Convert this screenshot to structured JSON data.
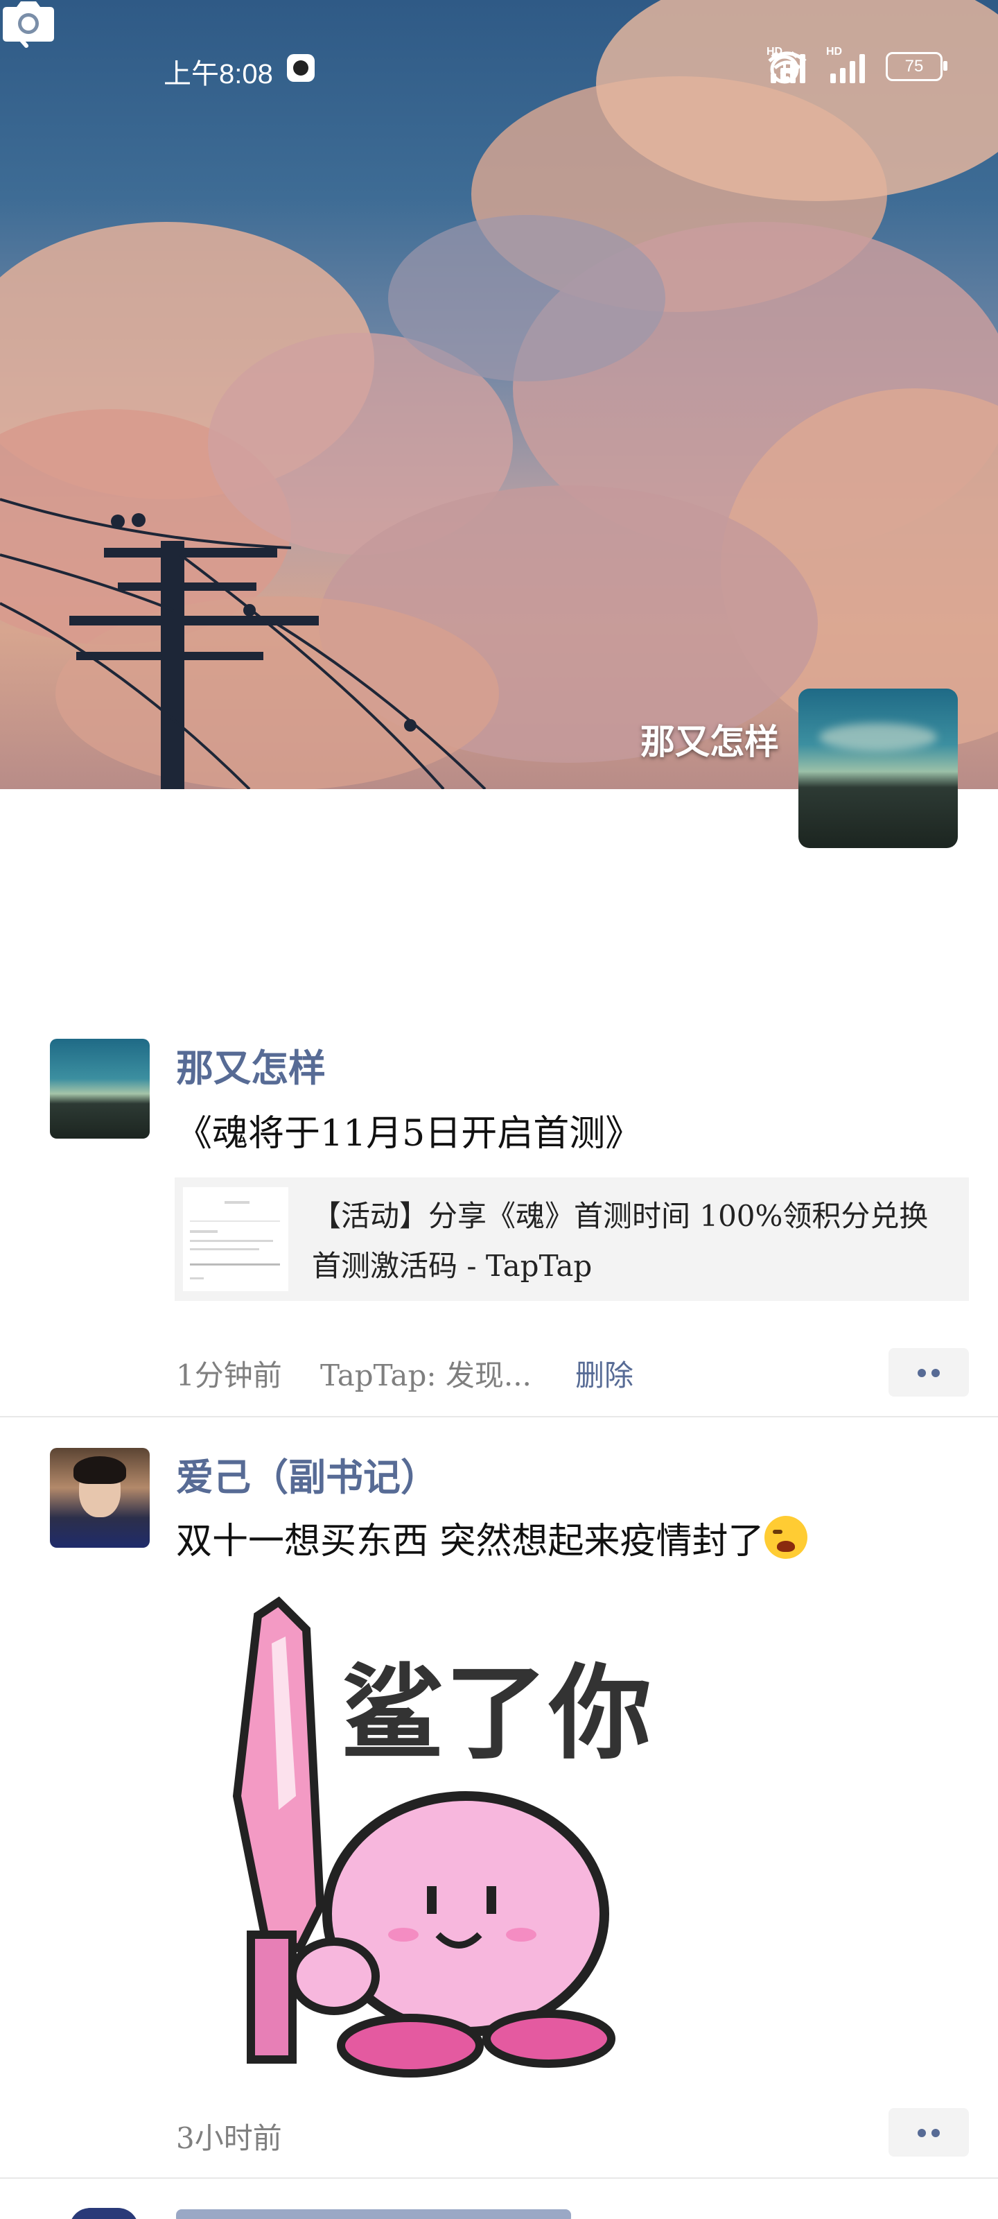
{
  "status_bar": {
    "time": "上午8:08",
    "battery": "75",
    "network_badge_1": "HD",
    "network_badge_2": "HD"
  },
  "cover": {
    "name": "那又怎样"
  },
  "posts": [
    {
      "nickname": "那又怎样",
      "text": "《魂将于11月5日开启首测》",
      "link_title": "【活动】分享《魂》首测时间 100%领积分兑换首测激活码 - TapTap",
      "time": "1分钟前",
      "source": "TapTap: 发现...",
      "delete": "删除"
    },
    {
      "nickname": "爱己（副书记）",
      "text": "双十一想买东西 突然想起来疫情封了",
      "sticker_text": "鲨了你",
      "time": "3小时前"
    }
  ],
  "colors": {
    "nickname": "#576b95",
    "meta": "#7f7f7f",
    "divider": "#e8e8e8"
  }
}
